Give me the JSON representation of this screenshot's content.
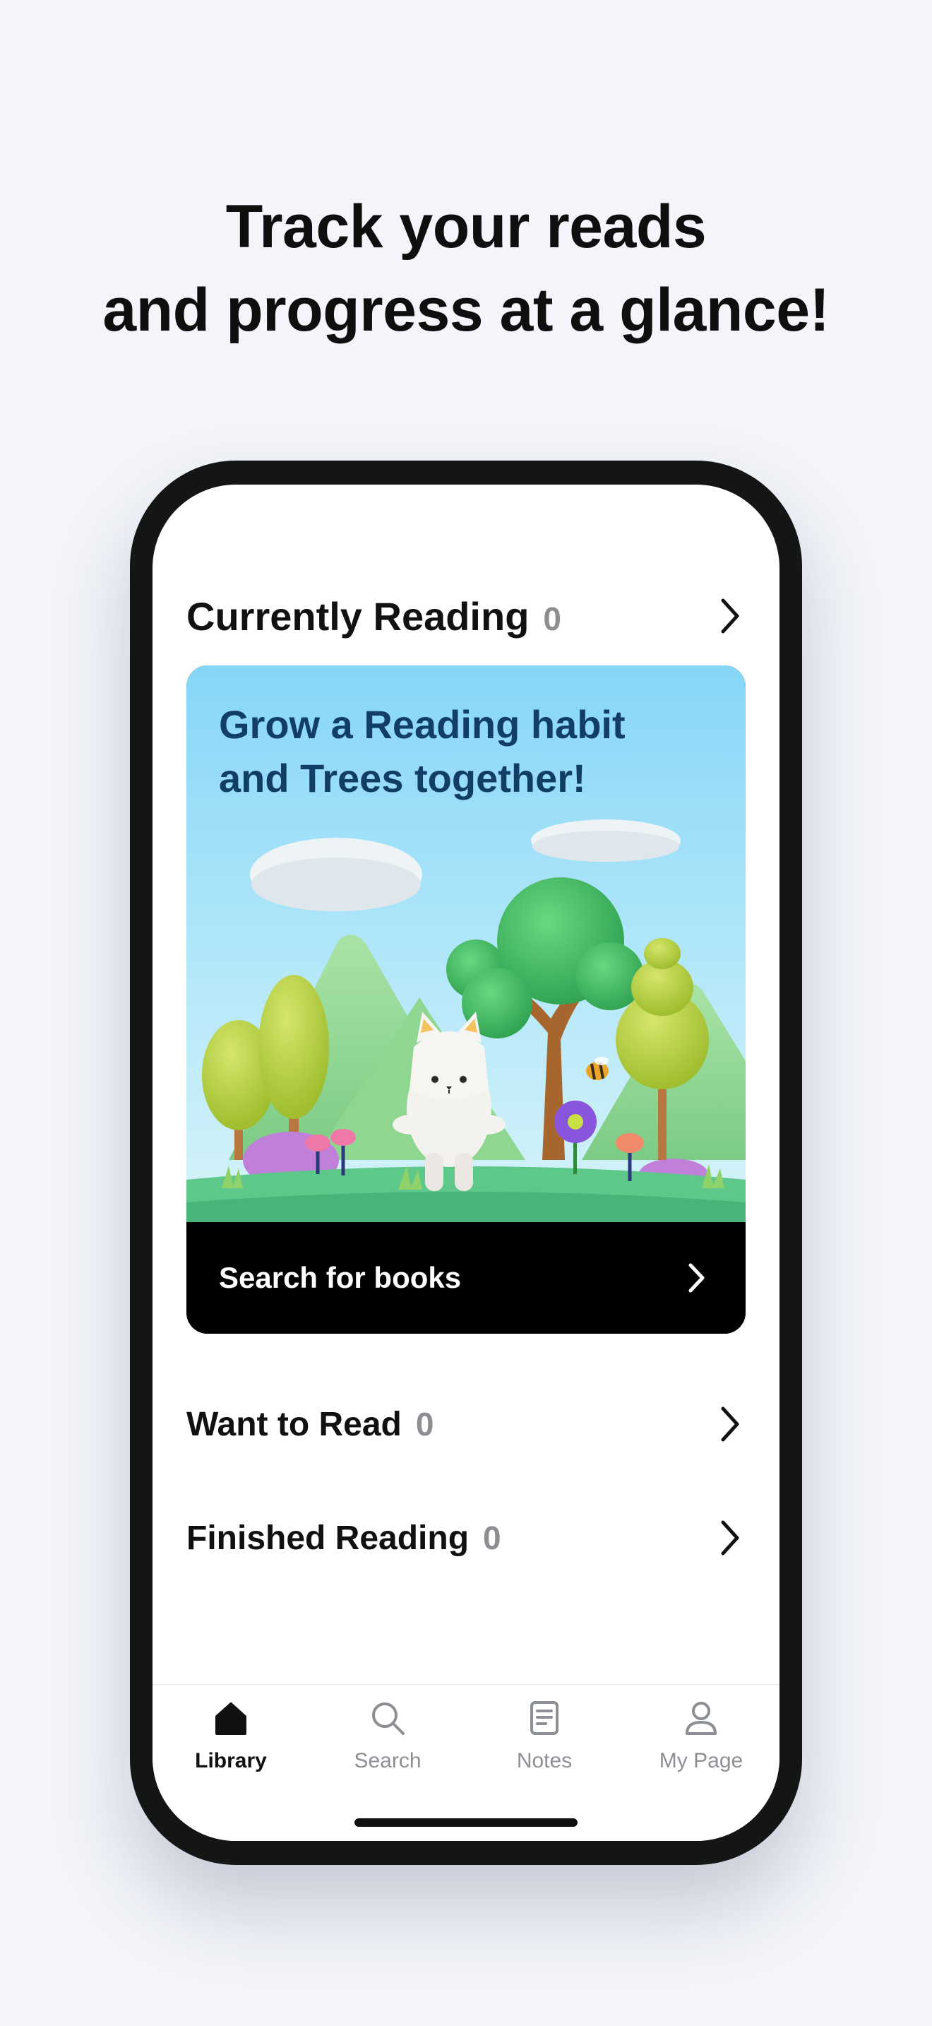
{
  "headline": {
    "line1": "Track your reads",
    "line2": "and progress at a glance!"
  },
  "library": {
    "currently_reading": {
      "label": "Currently Reading",
      "count": "0"
    },
    "promo": {
      "title_line1": "Grow a Reading habit",
      "title_line2": "and Trees together!",
      "action_label": "Search for books"
    },
    "want_to_read": {
      "label": "Want to Read",
      "count": "0"
    },
    "finished_reading": {
      "label": "Finished Reading",
      "count": "0"
    }
  },
  "tabbar": {
    "active": "Library",
    "items": [
      {
        "label": "Library",
        "icon": "home-icon"
      },
      {
        "label": "Search",
        "icon": "search-icon"
      },
      {
        "label": "Notes",
        "icon": "notes-icon"
      },
      {
        "label": "My Page",
        "icon": "person-icon"
      }
    ]
  },
  "colors": {
    "background": "#f3f5fa",
    "phone_frame": "#141616",
    "promo_title": "#123e66",
    "promo_bar": "#000000",
    "inactive_tab": "#8c8f94"
  }
}
